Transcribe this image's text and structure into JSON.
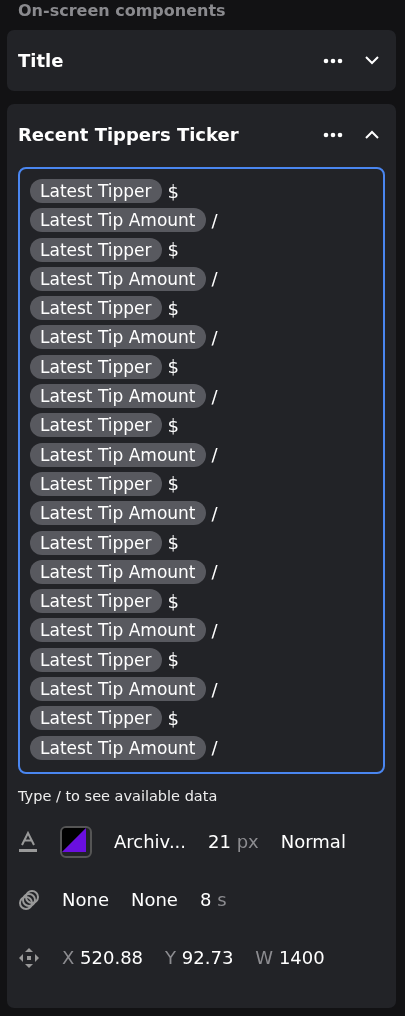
{
  "header": "On-screen components",
  "sections": [
    {
      "title": "Title",
      "expanded": false
    },
    {
      "title": "Recent Tippers Ticker",
      "expanded": true
    }
  ],
  "editor": {
    "focused": true,
    "lines": [
      {
        "token": "Latest Tipper",
        "suffix": "$"
      },
      {
        "token": "Latest Tip Amount",
        "suffix": "/"
      },
      {
        "token": "Latest Tipper",
        "suffix": "$"
      },
      {
        "token": "Latest Tip Amount",
        "suffix": "/"
      },
      {
        "token": "Latest Tipper",
        "suffix": "$"
      },
      {
        "token": "Latest Tip Amount",
        "suffix": "/"
      },
      {
        "token": "Latest Tipper",
        "suffix": "$"
      },
      {
        "token": "Latest Tip Amount",
        "suffix": "/"
      },
      {
        "token": "Latest Tipper",
        "suffix": "$"
      },
      {
        "token": "Latest Tip Amount",
        "suffix": "/"
      },
      {
        "token": "Latest Tipper",
        "suffix": "$"
      },
      {
        "token": "Latest Tip Amount",
        "suffix": "/"
      },
      {
        "token": "Latest Tipper",
        "suffix": "$"
      },
      {
        "token": "Latest Tip Amount",
        "suffix": "/"
      },
      {
        "token": "Latest Tipper",
        "suffix": "$"
      },
      {
        "token": "Latest Tip Amount",
        "suffix": "/"
      },
      {
        "token": "Latest Tipper",
        "suffix": "$"
      },
      {
        "token": "Latest Tip Amount",
        "suffix": "/"
      },
      {
        "token": "Latest Tipper",
        "suffix": "$"
      },
      {
        "token": "Latest Tip Amount",
        "suffix": "/"
      }
    ]
  },
  "hint": "Type / to see available data",
  "font_row": {
    "swatch": [
      {
        "color": "#000000"
      },
      {
        "color": "#6a0fe0"
      }
    ],
    "font": "Archiv...",
    "size": "21",
    "size_unit": "px",
    "weight": "Normal"
  },
  "animation_row": {
    "enter": "None",
    "exit": "None",
    "duration": "8",
    "duration_unit": "s"
  },
  "position_row": [
    {
      "label": "X",
      "value": "520.88"
    },
    {
      "label": "Y",
      "value": "92.73"
    },
    {
      "label": "W",
      "value": "1400"
    }
  ]
}
